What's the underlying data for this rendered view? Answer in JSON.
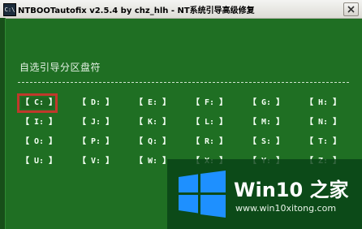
{
  "window": {
    "title": "NTBOOTautofix v2.5.4 by chz_hlh - NT系统引导高级修复"
  },
  "prompt": "自选引导分区盘符",
  "drives": {
    "selected": "C",
    "items": [
      "【 C: 】",
      "【 D: 】",
      "【 E: 】",
      "【 F: 】",
      "【 G: 】",
      "【 H: 】",
      "【 I: 】",
      "【 J: 】",
      "【 K: 】",
      "【 L: 】",
      "【 M: 】",
      "【 N: 】",
      "【 O: 】",
      "【 P: 】",
      "【 Q: 】",
      "【 R: 】",
      "【 S: 】",
      "【 T: 】",
      "【 U: 】",
      "【 V: 】",
      "【 W: 】",
      "【 X: 】",
      "【 Y: 】",
      "【 Z: 】"
    ]
  },
  "watermark": {
    "title": "Win10 之家",
    "url": "www.win10xitong.com",
    "icon": "windows-logo-icon"
  },
  "colors": {
    "background": "#1f6f23",
    "selection_border": "#c0392b",
    "logo_blue": "#1e90ff"
  }
}
